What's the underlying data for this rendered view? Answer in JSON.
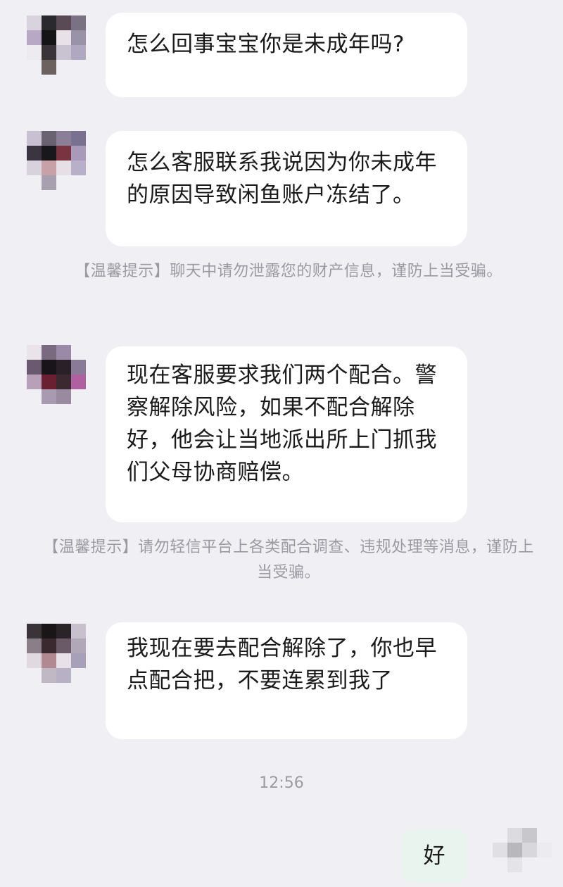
{
  "messages": [
    {
      "text": "怎么回事宝宝你是未成年吗?"
    },
    {
      "text": "怎么客服联系我说因为你未成年的原因导致闲鱼账户冻结了。"
    },
    {
      "text": "现在客服要求我们两个配合。警察解除风险，如果不配合解除好，他会让当地派出所上门抓我们父母协商赔偿。"
    },
    {
      "text": "我现在要去配合解除了，你也早点配合把，不要连累到我了"
    }
  ],
  "tips": [
    {
      "text": "【温馨提示】聊天中请勿泄露您的财产信息，谨防上当受骗。"
    },
    {
      "text": "【温馨提示】请勿轻信平台上各类配合调查、违规处理等消息，谨防上当受骗。"
    }
  ],
  "timestamp": "12:56",
  "reply": {
    "text": "好"
  },
  "colors": {
    "background": "#f0f0f4",
    "bubble": "#ffffff",
    "my_bubble": "#e9f4ef",
    "tip_text": "#9a9aa2"
  }
}
